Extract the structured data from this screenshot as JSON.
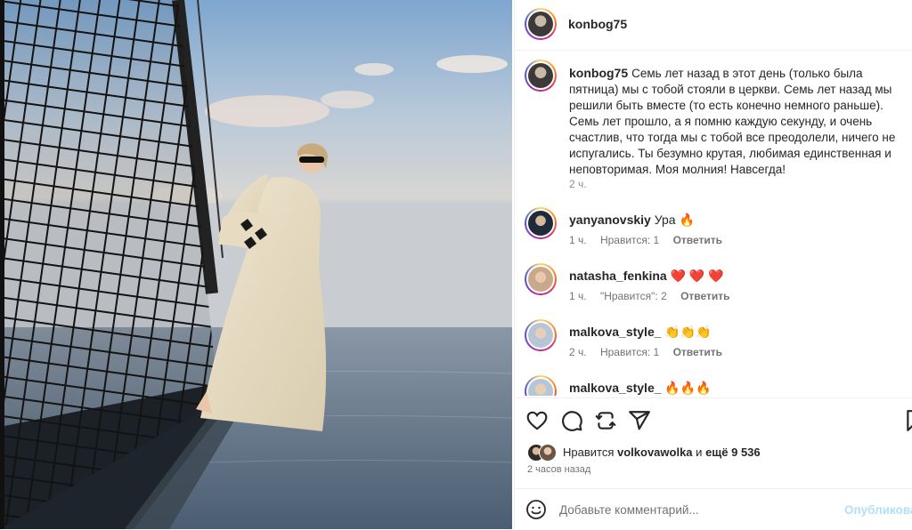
{
  "post": {
    "author": "konbog75",
    "caption": "Семь лет назад в этот день (только была пятница) мы с тобой стояли в церкви. Семь лет назад мы решили быть вместе (то есть конечно немного раньше). Семь лет прошло, а я помню каждую секунду, и очень счастлив, что тогда мы с тобой все преодолели, ничего не испугались. Ты безумно крутая, любимая единственная и неповторимая. Моя молния! Навсегда!",
    "caption_time": "2 ч.",
    "photo_icon": "photo-of-woman-on-yacht"
  },
  "comments": [
    {
      "user": "yanyanovskiy",
      "text": "Ура 🔥",
      "time": "1 ч.",
      "likes": "Нравится: 1",
      "reply": "Ответить"
    },
    {
      "user": "natasha_fenkina",
      "text": "❤️ ❤️ ❤️",
      "time": "1 ч.",
      "likes": "\"Нравится\": 2",
      "reply": "Ответить"
    },
    {
      "user": "malkova_style_",
      "text": "👏👏👏",
      "time": "2 ч.",
      "likes": "Нравится: 1",
      "reply": "Ответить"
    },
    {
      "user": "malkova_style_",
      "text": "🔥🔥🔥",
      "time": "",
      "likes": "",
      "reply": ""
    }
  ],
  "likes": {
    "prefix": "Нравится",
    "user": "volkovawolka",
    "middle": "и",
    "others": "ещё 9 536"
  },
  "post_time": "2 часов назад",
  "composer": {
    "placeholder": "Добавьте комментарий...",
    "publish": "Опубликовать"
  },
  "icons": {
    "like": "heart-icon",
    "comment": "comment-bubble-icon",
    "repost": "repost-icon",
    "share": "paper-plane-icon",
    "save": "bookmark-icon",
    "emoji": "smiley-icon"
  },
  "colors": {
    "text": "#262626",
    "secondary": "#737373",
    "publish_disabled": "#b2dffc",
    "heart_red": "#ed4956"
  }
}
